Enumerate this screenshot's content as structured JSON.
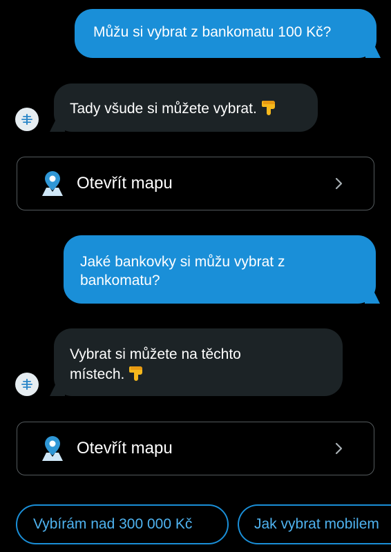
{
  "messages": [
    {
      "role": "user",
      "text": "Můžu si vybrat z bankomatu 100 Kč?"
    },
    {
      "role": "bot",
      "text": "Tady všude si můžete vybrat.",
      "emoji": "pointing-down-hand-icon"
    },
    {
      "role": "card",
      "label": "Otevřít mapu"
    },
    {
      "role": "user",
      "text_line1": "Jaké bankovky si můžu vybrat z",
      "text_line2": "bankomatu?"
    },
    {
      "role": "bot",
      "text_line1": "Vybrat si můžete na těchto",
      "text_line2": "místech.",
      "emoji": "pointing-down-hand-icon"
    },
    {
      "role": "card",
      "label": "Otevřít mapu"
    }
  ],
  "suggestions": [
    {
      "label": "Vybírám nad 300 000 Kč"
    },
    {
      "label": "Jak vybrat mobilem"
    }
  ],
  "colors": {
    "background": "#000000",
    "user_bubble": "#1a8fd8",
    "bot_bubble": "#1c2326",
    "chip_border": "#1a8fd8",
    "chip_text": "#4fb3f0",
    "card_border": "#555b5e",
    "pin": "#2f97d6"
  }
}
